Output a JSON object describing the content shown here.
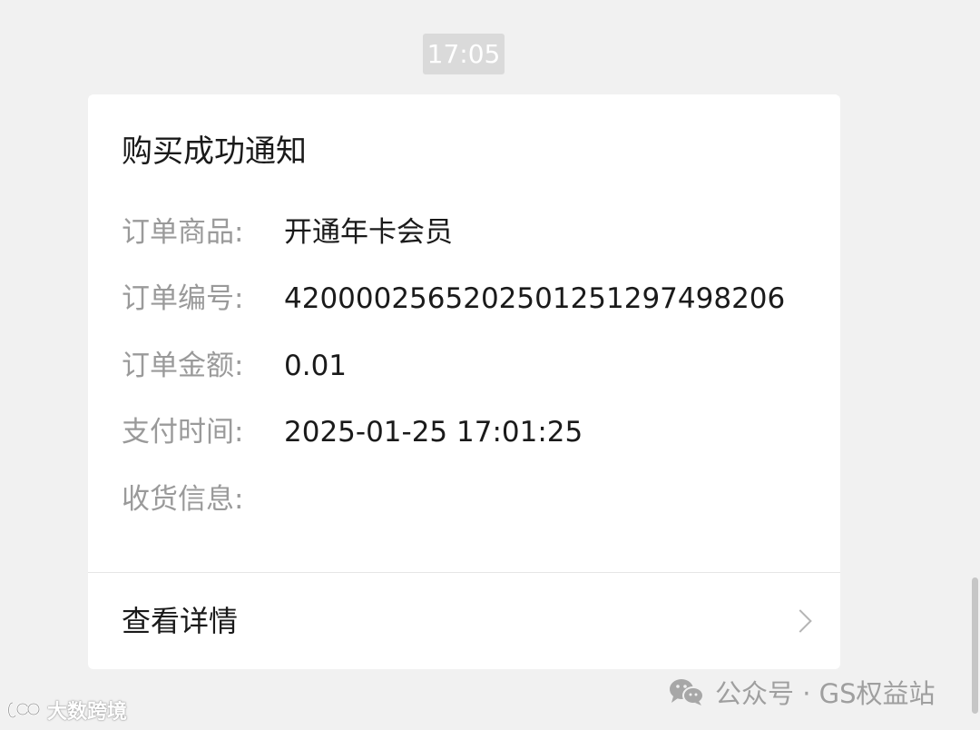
{
  "timestamp": "17:05",
  "card": {
    "title": "购买成功通知",
    "fields": [
      {
        "label": "订单商品:",
        "value": "开通年卡会员"
      },
      {
        "label": "订单编号:",
        "value": "4200002565202501251297498206"
      },
      {
        "label": "订单金额:",
        "value": "0.01"
      },
      {
        "label": "支付时间:",
        "value": "2025-01-25 17:01:25"
      },
      {
        "label": "收货信息:",
        "value": ""
      }
    ],
    "details_link": "查看详情"
  },
  "watermarks": {
    "left_text": "大数跨境",
    "right_text": "公众号 · GS权益站"
  },
  "icons": {
    "chevron": "chevron-right-icon",
    "wechat": "wechat-icon",
    "brand": "brand-logo-icon"
  }
}
